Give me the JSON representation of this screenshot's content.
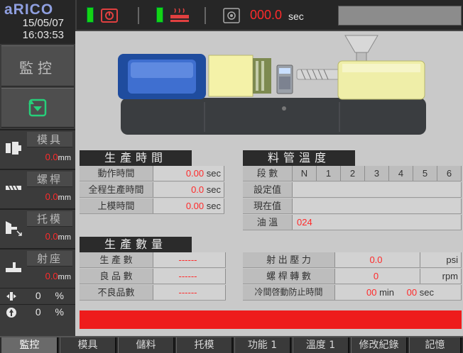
{
  "header": {
    "logo": "aRICO",
    "date": "15/05/07",
    "time": "16:03:53",
    "timer_value": "000.0",
    "timer_unit": "sec"
  },
  "sidebar": {
    "monitor_label": "監控",
    "positions": [
      {
        "label": "模具",
        "value": "0.0",
        "unit": "mm",
        "icon": "mold-icon"
      },
      {
        "label": "螺桿",
        "value": "0.0",
        "unit": "mm",
        "icon": "screw-icon"
      },
      {
        "label": "托模",
        "value": "0.0",
        "unit": "mm",
        "icon": "ejector-icon"
      },
      {
        "label": "射座",
        "value": "0.0",
        "unit": "mm",
        "icon": "injection-unit-icon"
      }
    ],
    "percents": [
      {
        "value": "0 %",
        "icon": "speed-icon"
      },
      {
        "value": "0 %",
        "icon": "pressure-icon"
      }
    ]
  },
  "production_time": {
    "title": "生產時間",
    "rows": [
      {
        "label": "動作時間",
        "value": "0.00",
        "unit": "sec"
      },
      {
        "label": "全程生產時間",
        "value": "0.0",
        "unit": "sec"
      },
      {
        "label": "上模時間",
        "value": "0.00",
        "unit": "sec"
      }
    ]
  },
  "barrel_temp": {
    "title": "料管溫度",
    "columns": [
      "段 數",
      "N",
      "1",
      "2",
      "3",
      "4",
      "5",
      "6"
    ],
    "rows": [
      {
        "label": "設定值"
      },
      {
        "label": "現在值"
      },
      {
        "label": "油 溫",
        "value": "024"
      }
    ]
  },
  "production_qty": {
    "title": "生產數量",
    "rows": [
      {
        "label": "生 產 數",
        "value": "------"
      },
      {
        "label": "良 品 數",
        "value": "------"
      },
      {
        "label": "不良品數",
        "value": "------"
      }
    ]
  },
  "process_values": {
    "rows": [
      {
        "label": "射 出 壓 力",
        "value": "0.0",
        "unit": "psi"
      },
      {
        "label": "螺 桿 轉 數",
        "value": "0",
        "unit": "rpm"
      }
    ],
    "idle_label": "冷間啓動防止時間",
    "idle_min_value": "00",
    "idle_min_unit": "min",
    "idle_sec_value": "00",
    "idle_sec_unit": "sec"
  },
  "bottom_nav": [
    "監控",
    "模具",
    "儲料",
    "托模",
    "功能 1",
    "溫度 1",
    "修改紀錄",
    "記憶"
  ],
  "colors": {
    "alarm": "#ee1c1c",
    "value_red": "#ff2a2a",
    "status_green": "#14d414"
  }
}
